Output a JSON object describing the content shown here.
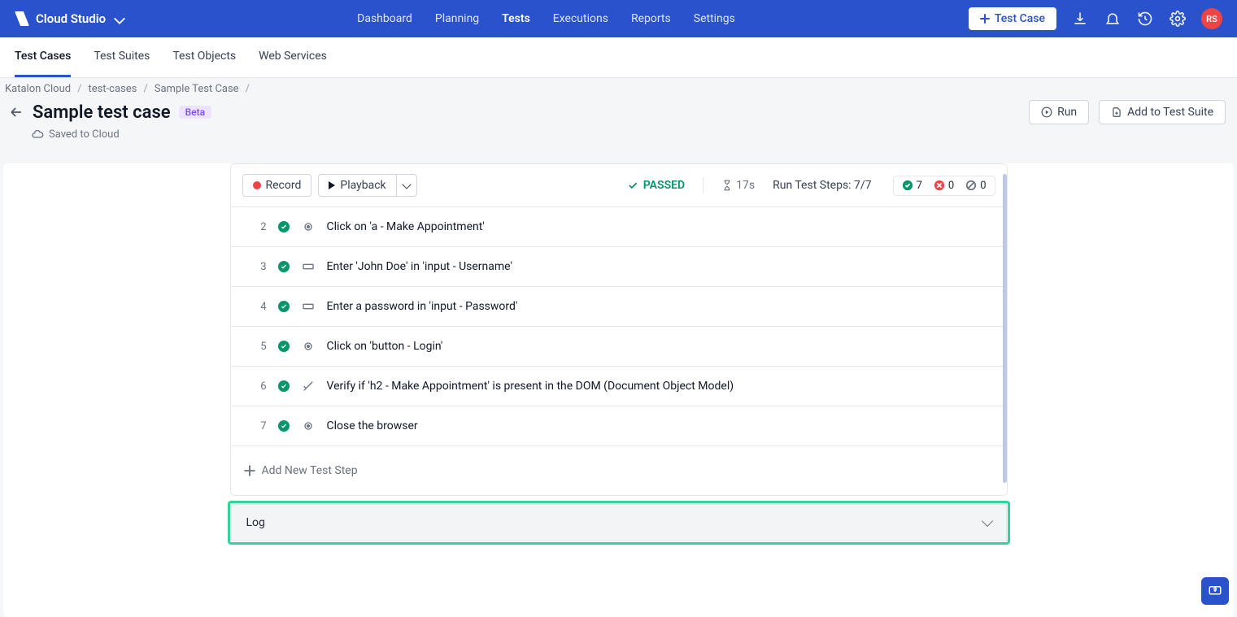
{
  "brand": "Cloud Studio",
  "avatar_initials": "RS",
  "topnav": [
    "Dashboard",
    "Planning",
    "Tests",
    "Executions",
    "Reports",
    "Settings"
  ],
  "topnav_active": 2,
  "new_test_case_label": "Test Case",
  "subtabs": [
    "Test Cases",
    "Test Suites",
    "Test Objects",
    "Web Services"
  ],
  "subtabs_active": 0,
  "breadcrumbs": [
    "Katalon Cloud",
    "test-cases",
    "Sample Test Case"
  ],
  "title": "Sample test case",
  "badge": "Beta",
  "saved_status": "Saved to Cloud",
  "actions": {
    "run": "Run",
    "add_to_suite": "Add to Test Suite"
  },
  "toolbar": {
    "record": "Record",
    "playback": "Playback",
    "status": "PASSED",
    "duration": "17s",
    "run_steps_label": "Run Test Steps:",
    "run_steps_value": "7/7",
    "pass_count": "7",
    "fail_count": "0",
    "skip_count": "0"
  },
  "steps": [
    {
      "num": "2",
      "kind": "click",
      "desc": "Click on 'a - Make Appointment'"
    },
    {
      "num": "3",
      "kind": "input",
      "desc": "Enter 'John Doe' in 'input - Username'"
    },
    {
      "num": "4",
      "kind": "input",
      "desc": "Enter a password in 'input - Password'"
    },
    {
      "num": "5",
      "kind": "click",
      "desc": "Click on 'button - Login'"
    },
    {
      "num": "6",
      "kind": "verify",
      "desc": "Verify if 'h2 - Make Appointment' is present in the DOM (Document Object Model)"
    },
    {
      "num": "7",
      "kind": "click",
      "desc": "Close the browser"
    }
  ],
  "add_step_label": "Add New Test Step",
  "log_label": "Log"
}
